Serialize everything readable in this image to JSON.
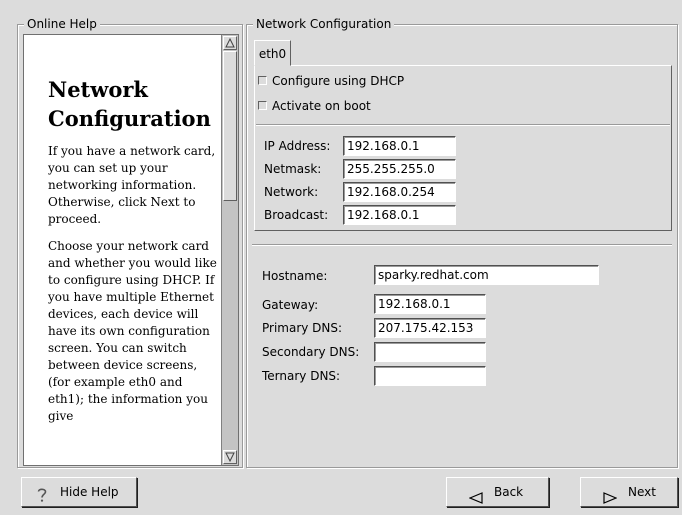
{
  "help": {
    "group_title": "Online Help",
    "heading": "Network Configuration",
    "paragraphs": [
      "If you have a network card, you can set up your networking information. Otherwise, click Next to proceed.",
      "Choose your network card and whether you would like to configure using DHCP. If you have multiple Ethernet devices, each device will have its own configuration screen. You can switch between device screens, (for example eth0 and eth1); the information you give"
    ]
  },
  "network": {
    "group_title": "Network Configuration",
    "tab_label": "eth0",
    "dhcp_label": "Configure using DHCP",
    "activate_label": "Activate on boot",
    "dhcp_checked": false,
    "activate_checked": false,
    "ip_label": "IP Address:",
    "ip_value": "192.168.0.1",
    "netmask_label": "Netmask:",
    "netmask_value": "255.255.255.0",
    "network_label": "Network:",
    "network_value": "192.168.0.254",
    "broadcast_label": "Broadcast:",
    "broadcast_value": "192.168.0.1",
    "hostname_label": "Hostname:",
    "hostname_value": "sparky.redhat.com",
    "gateway_label": "Gateway:",
    "gateway_value": "192.168.0.1",
    "primary_dns_label": "Primary DNS:",
    "primary_dns_value": "207.175.42.153",
    "secondary_dns_label": "Secondary DNS:",
    "secondary_dns_value": "",
    "ternary_dns_label": "Ternary DNS:",
    "ternary_dns_value": ""
  },
  "buttons": {
    "hide_help": "Hide Help",
    "back": "Back",
    "next": "Next"
  },
  "icons": {
    "hide_help": "question-mark-icon",
    "back": "left-triangle-icon",
    "next": "right-triangle-icon",
    "scroll_up": "scroll-up-arrow-icon",
    "scroll_down": "scroll-down-arrow-icon"
  }
}
